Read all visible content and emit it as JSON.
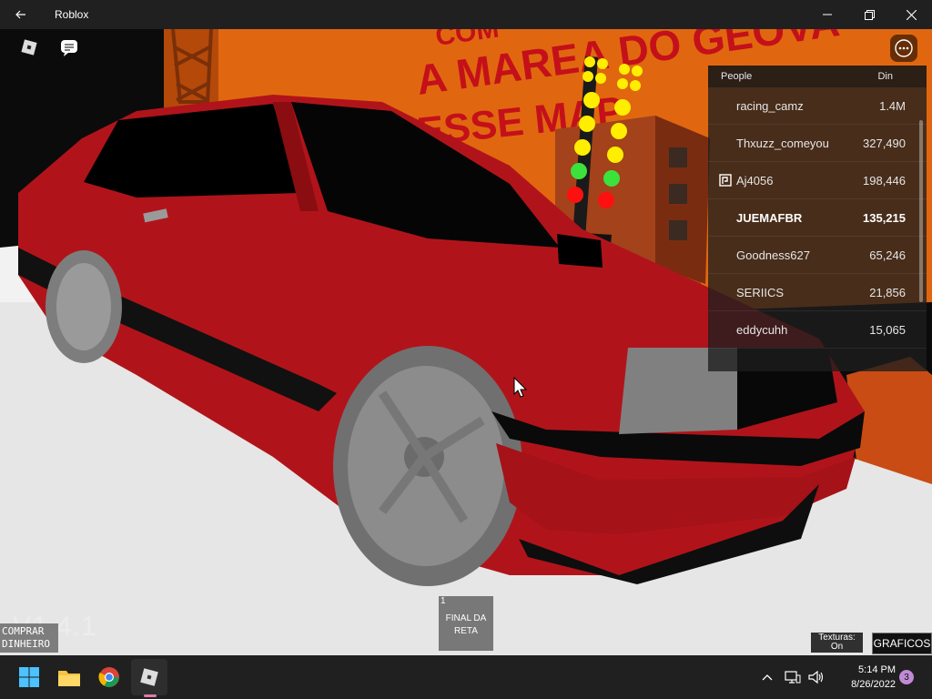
{
  "window": {
    "title": "Roblox"
  },
  "game": {
    "banner_line1": "A MAREA DO GEOVA",
    "banner_line2": "ESSE MAP",
    "banner_top": "COM",
    "leaderboard": {
      "col_people": "People",
      "col_stat": "Din",
      "rows": [
        {
          "name": "racing_camz",
          "value": "1.4M"
        },
        {
          "name": "Thxuzz_comeyou",
          "value": "327,490"
        },
        {
          "name": "Aj4056",
          "value": "198,446"
        },
        {
          "name": "JUEMAFBR",
          "value": "135,215"
        },
        {
          "name": "Goodness627",
          "value": "65,246"
        },
        {
          "name": "SERIICS",
          "value": "21,856"
        },
        {
          "name": "eddycuhh",
          "value": "15,065"
        }
      ]
    },
    "version": "V1.4.1",
    "comprar_line1": "COMPRAR",
    "comprar_line2": "DINHEIRO",
    "hotbar_slot": {
      "number": "1",
      "line1": "FINAL DA",
      "line2": "RETA"
    },
    "texturas_line1": "Texturas:",
    "texturas_line2": "On",
    "graficos": "GRAFICOS"
  },
  "taskbar": {
    "time": "5:14 PM",
    "date": "8/26/2022",
    "notification_count": "3"
  },
  "colors": {
    "car_red": "#b0141a",
    "wall_orange": "#e06a10",
    "banner_red": "#c4101a",
    "taskbar": "#202020"
  }
}
